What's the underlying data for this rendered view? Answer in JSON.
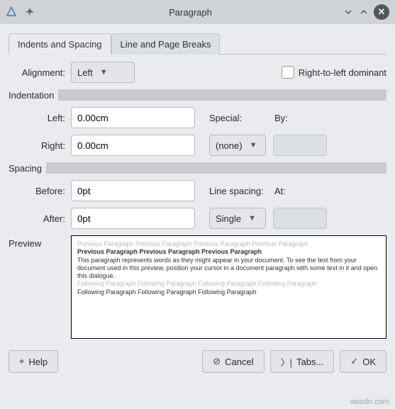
{
  "window": {
    "title": "Paragraph"
  },
  "tabs": {
    "active": "Indents and Spacing",
    "inactive": "Line and Page Breaks"
  },
  "alignment": {
    "label": "Alignment:",
    "value": "Left"
  },
  "rtl": {
    "label": "Right-to-left dominant",
    "checked": false
  },
  "sections": {
    "indentation": "Indentation",
    "spacing": "Spacing",
    "preview": "Preview"
  },
  "indent": {
    "left_label": "Left:",
    "left_value": "0.00cm",
    "right_label": "Right:",
    "right_value": "0.00cm",
    "special_label": "Special:",
    "special_value": "(none)",
    "by_label": "By:"
  },
  "spacing": {
    "before_label": "Before:",
    "before_value": "0pt",
    "after_label": "After:",
    "after_value": "0pt",
    "line_label": "Line spacing:",
    "line_value": "Single",
    "at_label": "At:"
  },
  "preview": {
    "prev_faint": "Previous Paragraph Previous Paragraph Previous Paragraph Previous Paragraph",
    "prev_bold": "Previous Paragraph Previous Paragraph Previous Paragraph",
    "body": "This paragraph represents words as they might appear in your document.  To see the text from your document used in this preview, position your cursor in a document paragraph with some text in it and open this dialogue.",
    "follow_faint": "Following Paragraph Following Paragraph Following Paragraph Following Paragraph",
    "follow_normal": "Following Paragraph Following Paragraph Following Paragraph"
  },
  "buttons": {
    "help": "Help",
    "cancel": "Cancel",
    "tabs": "Tabs...",
    "ok": "OK"
  },
  "watermark": "wsxdn.com"
}
